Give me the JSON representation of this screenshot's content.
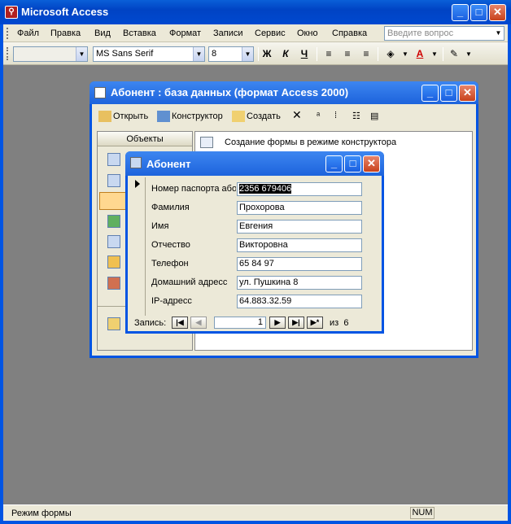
{
  "app": {
    "title": "Microsoft Access",
    "icon": "access-icon"
  },
  "menu": [
    "Файл",
    "Правка",
    "Вид",
    "Вставка",
    "Формат",
    "Записи",
    "Сервис",
    "Окно",
    "Справка"
  ],
  "help_placeholder": "Введите вопрос",
  "format_toolbar": {
    "font_name": "MS Sans Serif",
    "font_size": "8",
    "bold": "Ж",
    "italic": "К",
    "underline": "Ч",
    "font_color_letter": "A"
  },
  "status": {
    "text": "Режим формы",
    "num": "NUM"
  },
  "db_window": {
    "title": "Абонент : база данных (формат Access 2000)",
    "toolbar": {
      "open": "Открыть",
      "design": "Конструктор",
      "create": "Создать"
    },
    "objects_header": "Объекты",
    "list": [
      "Создание формы в режиме конструктора"
    ]
  },
  "form": {
    "title": "Абонент",
    "fields": [
      {
        "label": "Номер паспорта або",
        "value": "2356 679406",
        "selected": true
      },
      {
        "label": "Фамилия",
        "value": "Прохорова"
      },
      {
        "label": "Имя",
        "value": "Евгения"
      },
      {
        "label": "Отчество",
        "value": "Викторовна"
      },
      {
        "label": "Телефон",
        "value": "65 84 97"
      },
      {
        "label": "Домашний адресс",
        "value": "ул. Пушкина 8"
      },
      {
        "label": "IP-адресс",
        "value": "64.883.32.59"
      }
    ],
    "nav": {
      "label": "Запись:",
      "current": "1",
      "of_label": "из",
      "total": "6"
    }
  },
  "colors": {
    "titlebar": "#0054e3",
    "workspace": "#808080",
    "face": "#ece9d8"
  }
}
